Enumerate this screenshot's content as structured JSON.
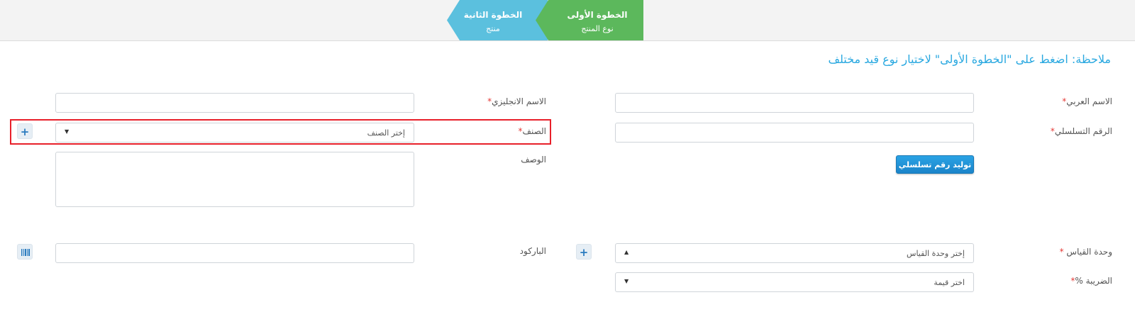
{
  "steps": [
    {
      "title": "الخطوة الأولى",
      "subtitle": "نوع المنتج",
      "color": "#5cb85c"
    },
    {
      "title": "الخطوة الثانية",
      "subtitle": "منتج",
      "color": "#5bc0de"
    }
  ],
  "note": "ملاحظة: اضغط على \"الخطوة الأولى\" لاختيار نوع قيد مختلف",
  "form": {
    "arabic_name_label": "الاسم العربي",
    "english_name_label": "الاسم الانجليزي",
    "serial_label": "الرقم التسلسلي",
    "category_label": "الصنف",
    "category_placeholder": "إختر الصنف",
    "description_label": "الوصف",
    "generate_serial_button": "توليد رقم تسلسلي",
    "unit_label": "وحدة القياس",
    "unit_placeholder": "إختر وحدة القياس",
    "barcode_label": "الباركود",
    "tax_label": "الضريبة %",
    "tax_placeholder": "اختر قيمة",
    "required_mark": "*"
  },
  "colors": {
    "accent": "#29a8e0",
    "required": "#e53935",
    "highlight": "#e8202a",
    "button": "#1b84c9"
  }
}
